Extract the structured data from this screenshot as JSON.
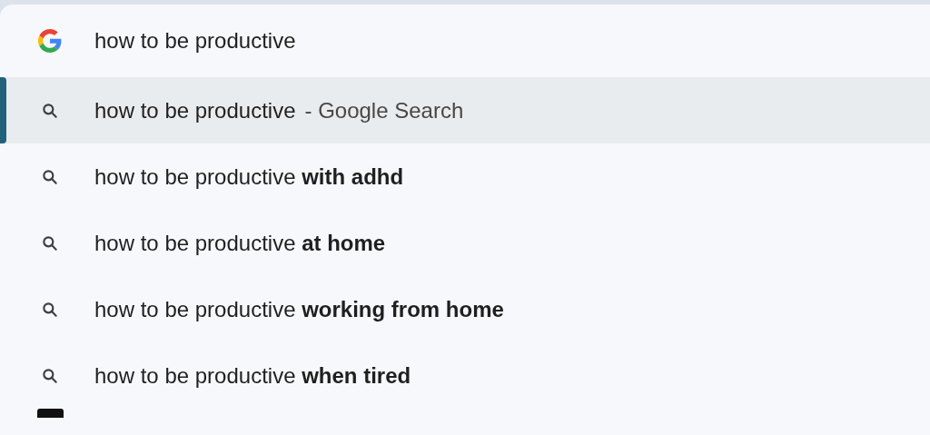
{
  "query": {
    "value": "how to be productive"
  },
  "suggestions": [
    {
      "text": "how to be productive",
      "detail": "- Google Search",
      "selected": true
    },
    {
      "text": "how to be productive **with adhd**",
      "selected": false
    },
    {
      "text": "how to be productive **at home**",
      "selected": false
    },
    {
      "text": "how to be productive **working from home**",
      "selected": false
    },
    {
      "text": "how to be productive **when tired**",
      "selected": false
    }
  ]
}
